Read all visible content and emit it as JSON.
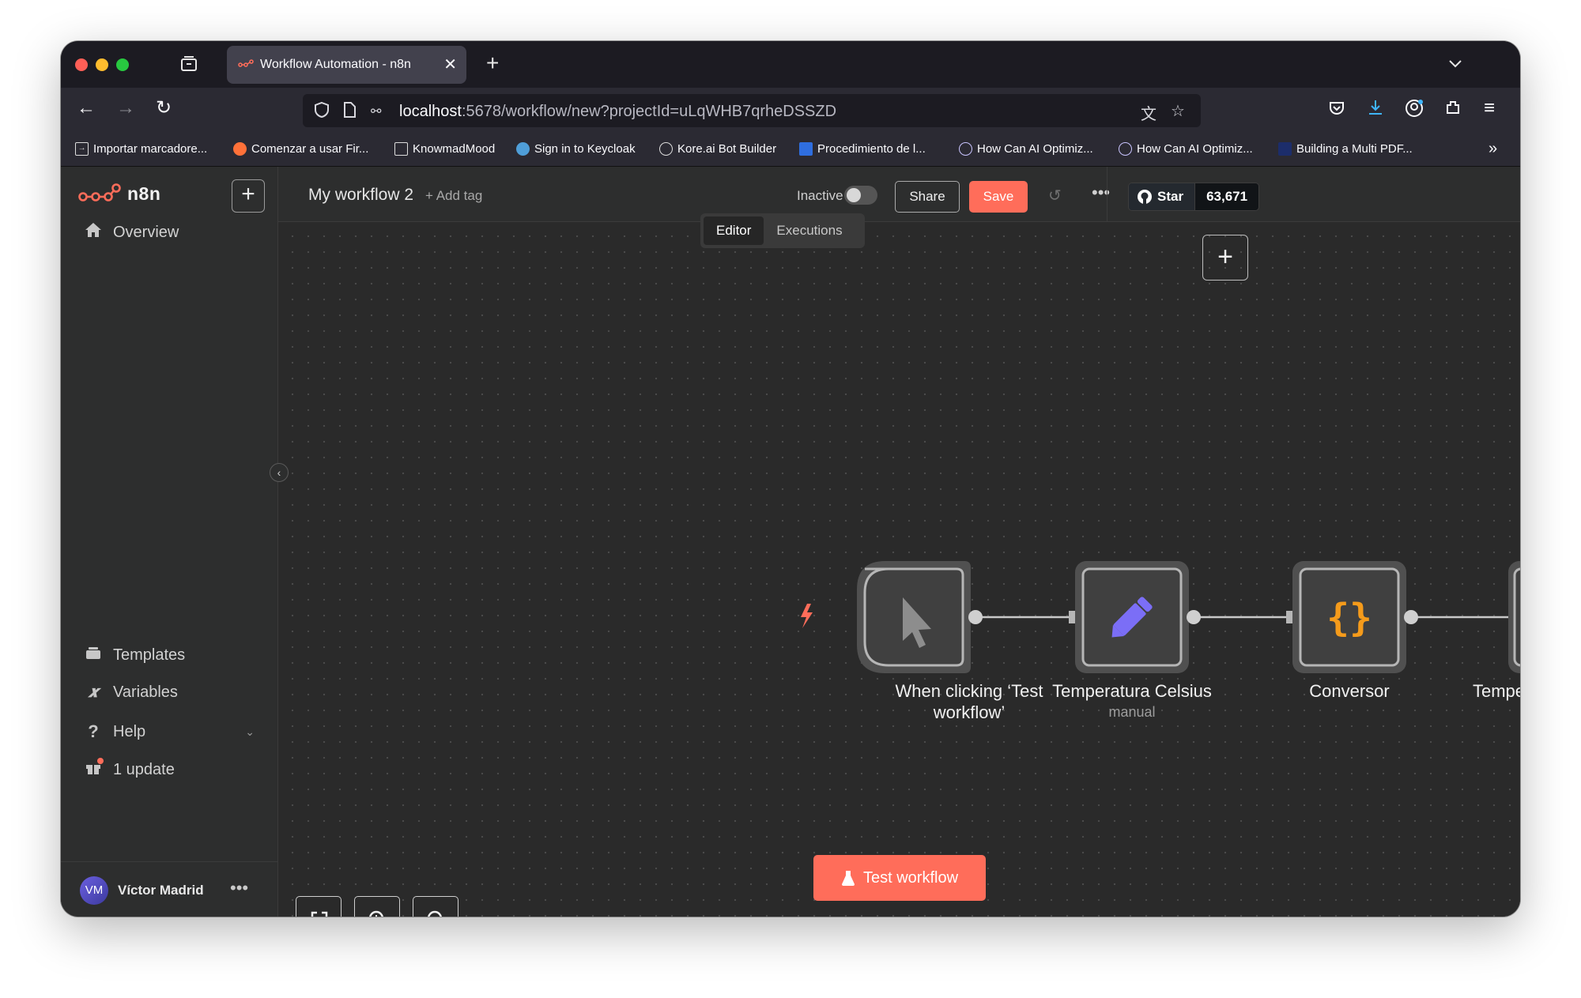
{
  "browser": {
    "tab_title": "Workflow Automation - n8n",
    "url_host": "localhost",
    "url_rest": ":5678/workflow/new?projectId=uLqWHB7qrheDSSZD",
    "bookmarks": [
      "Importar marcadore...",
      "Comenzar a usar Fir...",
      "KnowmadMood",
      "Sign in to Keycloak",
      "Kore.ai Bot Builder",
      "Procedimiento de l...",
      "How Can AI Optimiz...",
      "How Can AI Optimiz...",
      "Building a Multi PDF..."
    ]
  },
  "sidebar": {
    "logo": "n8n",
    "overview": "Overview",
    "templates": "Templates",
    "variables": "Variables",
    "help": "Help",
    "update": "1 update",
    "user_initials": "VM",
    "user_name": "Víctor Madrid"
  },
  "header": {
    "workflow_name": "My workflow 2",
    "add_tag": "+ Add tag",
    "status": "Inactive",
    "share": "Share",
    "save": "Save",
    "github_star": "Star",
    "github_count": "63,671"
  },
  "view_tabs": {
    "editor": "Editor",
    "executions": "Executions"
  },
  "nodes": [
    {
      "label_line1": "When clicking ‘Test",
      "label_line2": "workflow’",
      "icon": "pointer-icon"
    },
    {
      "label": "Temperatura Celsius",
      "subtitle": "manual",
      "icon": "pencil-icon"
    },
    {
      "label": "Conversor",
      "icon": "braces-icon"
    },
    {
      "label": "Tempe",
      "icon": "node-icon"
    }
  ],
  "test_button": "Test workflow",
  "colors": {
    "accent": "#ff6d5a",
    "node_border": "#b6b6b6",
    "braces": "#f59b1b",
    "pencil": "#7b6ef6"
  }
}
